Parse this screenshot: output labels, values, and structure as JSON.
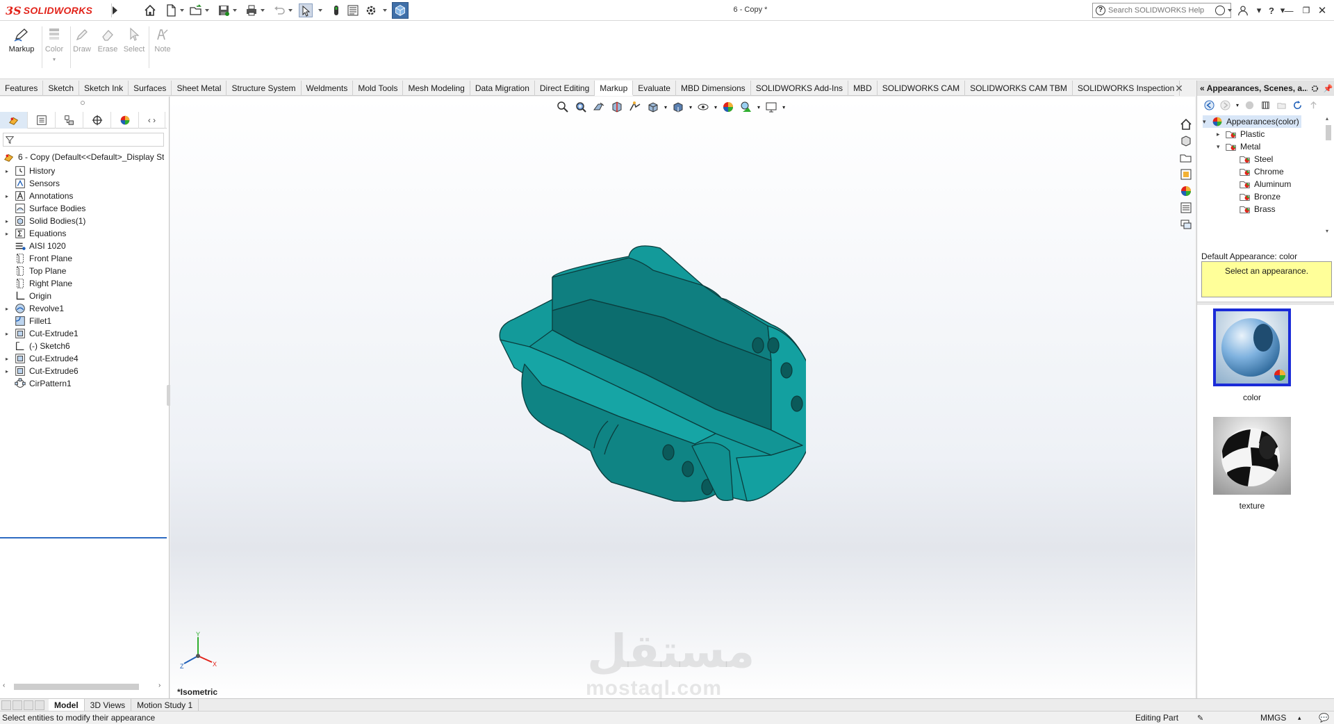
{
  "app": {
    "logo_ds": "3S",
    "logo_text": "SOLIDWORKS",
    "document_title": "6 - Copy *",
    "search_placeholder": "Search SOLIDWORKS Help",
    "accent_color": "#e2231a"
  },
  "quick_access": [
    "home-icon",
    "new-file-icon",
    "open-file-icon",
    "save-icon",
    "print-icon",
    "undo-icon",
    "select-icon",
    "rebuild-icon",
    "file-properties-icon",
    "options-icon",
    "view-cube-icon"
  ],
  "command_manager": {
    "buttons": [
      {
        "label": "Markup",
        "enabled": true
      },
      {
        "label": "Color",
        "enabled": false
      },
      {
        "label": "Draw",
        "enabled": false
      },
      {
        "label": "Erase",
        "enabled": false
      },
      {
        "label": "Select",
        "enabled": false
      },
      {
        "label": "Note",
        "enabled": false
      }
    ]
  },
  "tabs": [
    "Features",
    "Sketch",
    "Sketch Ink",
    "Surfaces",
    "Sheet Metal",
    "Structure System",
    "Weldments",
    "Mold Tools",
    "Mesh Modeling",
    "Data Migration",
    "Direct Editing",
    "Markup",
    "Evaluate",
    "MBD Dimensions",
    "SOLIDWORKS Add-Ins",
    "MBD",
    "SOLIDWORKS CAM",
    "SOLIDWORKS CAM TBM",
    "SOLIDWORKS Inspection"
  ],
  "active_tab": "Markup",
  "feature_tree": {
    "root": "6 - Copy  (Default<<Default>_Display St",
    "items": [
      {
        "label": "History",
        "expandable": true,
        "icon": "history-icon"
      },
      {
        "label": "Sensors",
        "expandable": false,
        "icon": "sensor-icon"
      },
      {
        "label": "Annotations",
        "expandable": true,
        "icon": "annotation-icon"
      },
      {
        "label": "Surface Bodies",
        "expandable": false,
        "icon": "surface-bodies-icon"
      },
      {
        "label": "Solid Bodies(1)",
        "expandable": true,
        "icon": "solid-bodies-icon"
      },
      {
        "label": "Equations",
        "expandable": true,
        "icon": "equations-icon"
      },
      {
        "label": "AISI 1020",
        "expandable": false,
        "icon": "material-icon"
      },
      {
        "label": "Front Plane",
        "expandable": false,
        "icon": "plane-icon"
      },
      {
        "label": "Top Plane",
        "expandable": false,
        "icon": "plane-icon"
      },
      {
        "label": "Right Plane",
        "expandable": false,
        "icon": "plane-icon"
      },
      {
        "label": "Origin",
        "expandable": false,
        "icon": "origin-icon"
      },
      {
        "label": "Revolve1",
        "expandable": true,
        "icon": "revolve-icon"
      },
      {
        "label": "Fillet1",
        "expandable": false,
        "icon": "fillet-icon"
      },
      {
        "label": "Cut-Extrude1",
        "expandable": true,
        "icon": "cut-extrude-icon"
      },
      {
        "label": "(-) Sketch6",
        "expandable": false,
        "icon": "sketch-icon"
      },
      {
        "label": "Cut-Extrude4",
        "expandable": true,
        "icon": "cut-extrude-icon"
      },
      {
        "label": "Cut-Extrude6",
        "expandable": true,
        "icon": "cut-extrude-icon"
      },
      {
        "label": "CirPattern1",
        "expandable": false,
        "icon": "circular-pattern-icon"
      }
    ]
  },
  "graphics": {
    "view_name": "*Isometric",
    "model_color": "#139a9a",
    "watermark_ar": "مستقل",
    "watermark_en": "mostaql.com",
    "triad_labels": [
      "Y",
      "X",
      "Z"
    ]
  },
  "task_pane": {
    "title": "Appearances, Scenes, a...",
    "tree": [
      {
        "label": "Appearances(color)",
        "level": 0,
        "expanded": true,
        "selected": true
      },
      {
        "label": "Plastic",
        "level": 1,
        "expanded": false
      },
      {
        "label": "Metal",
        "level": 1,
        "expanded": true
      },
      {
        "label": "Steel",
        "level": 2
      },
      {
        "label": "Chrome",
        "level": 2
      },
      {
        "label": "Aluminum",
        "level": 2
      },
      {
        "label": "Bronze",
        "level": 2
      },
      {
        "label": "Brass",
        "level": 2
      }
    ],
    "default_appearance": "Default Appearance: color",
    "hint": "Select an appearance.",
    "swatches": [
      {
        "label": "color",
        "selected": true
      },
      {
        "label": "texture",
        "selected": false
      }
    ]
  },
  "bottom_tabs": [
    "Model",
    "3D Views",
    "Motion Study 1"
  ],
  "active_bottom_tab": "Model",
  "status": {
    "message": "Select entities to modify their appearance",
    "mode": "Editing Part",
    "units": "MMGS"
  }
}
